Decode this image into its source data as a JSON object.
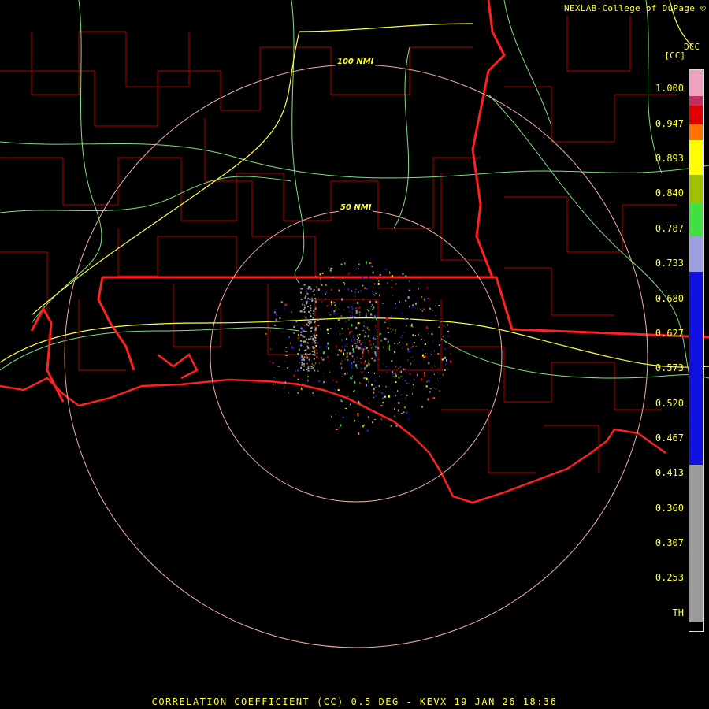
{
  "header": {
    "credit": "NEXLAB-College of DuPage ©",
    "product_code": "DCC",
    "unit": "[CC]"
  },
  "rings": [
    {
      "label": "100 NMI"
    },
    {
      "label": "50 NMI"
    }
  ],
  "legend": {
    "labels": [
      "1.000",
      "0.947",
      "0.893",
      "0.840",
      "0.787",
      "0.733",
      "0.680",
      "0.627",
      "0.573",
      "0.520",
      "0.467",
      "0.413",
      "0.360",
      "0.307",
      "0.253",
      "TH"
    ],
    "colors": {
      "pink": "#f0a0c0",
      "magenta": "#c03060",
      "red": "#e00000",
      "orange": "#ff7000",
      "yellow": "#ffff00",
      "olive": "#a0c000",
      "green": "#40e040",
      "lavender": "#a0a0e0",
      "blue": "#1010e0",
      "gray": "#9a9a9a",
      "black": "#000000"
    }
  },
  "footer": {
    "title": "CORRELATION COEFFICIENT (CC) 0.5 DEG - KEVX 19 JAN 26 18:36"
  },
  "map_colors": {
    "county": "#b00000",
    "state": "#ff2020",
    "highway": "#80e080",
    "interstate": "#ffff40",
    "ring": "#f0b0a0"
  }
}
